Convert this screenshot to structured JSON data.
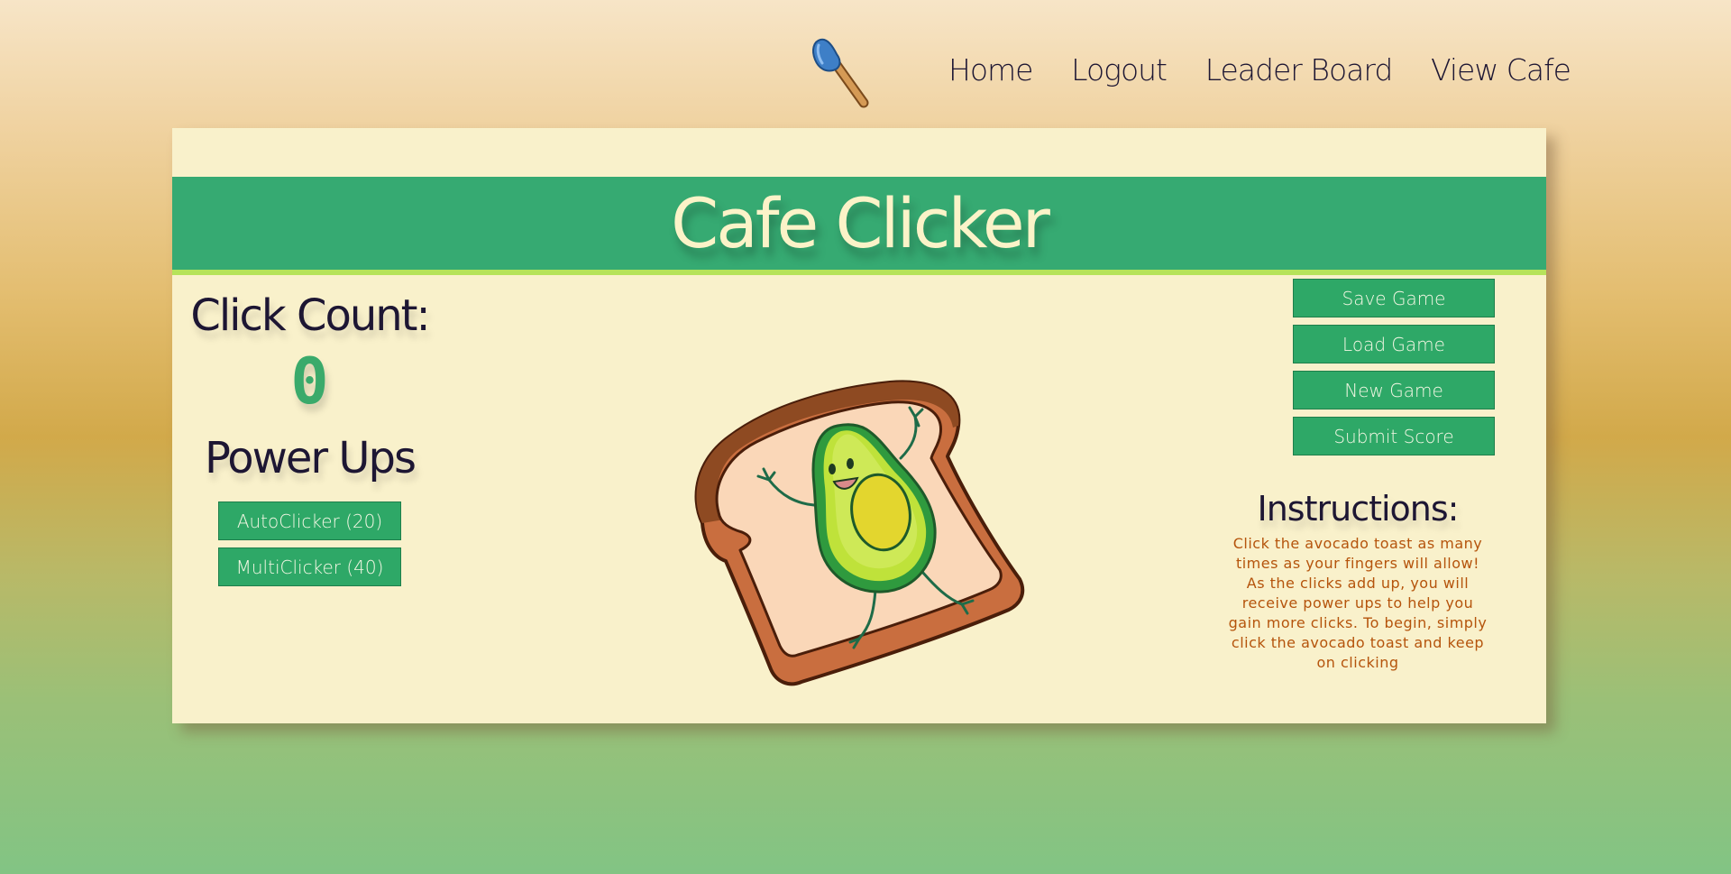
{
  "nav": {
    "logo_icon": "spatula-icon",
    "links": [
      "Home",
      "Logout",
      "Leader Board",
      "View Cafe"
    ]
  },
  "banner": {
    "title": "Cafe Clicker"
  },
  "stats": {
    "click_count_label": "Click Count:",
    "click_count_value": "0"
  },
  "powerups": {
    "label": "Power Ups",
    "buttons": [
      "AutoClicker (20)",
      "MultiClicker (40)"
    ]
  },
  "clicker": {
    "icon": "avocado-toast-icon"
  },
  "game_controls": {
    "buttons": [
      "Save Game",
      "Load Game",
      "New Game",
      "Submit Score"
    ]
  },
  "instructions": {
    "title": "Instructions:",
    "text": "Click the avocado toast as many times as your fingers will allow! As the clicks add up, you will receive power ups to help you gain more clicks. To begin, simply click the avocado toast and keep on clicking"
  },
  "colors": {
    "banner_green": "#36aa72",
    "button_green": "#2ea867",
    "panel_cream": "#f9f1cb",
    "instruction_orange": "#b5540c",
    "banner_underline": "#b6e35a"
  }
}
